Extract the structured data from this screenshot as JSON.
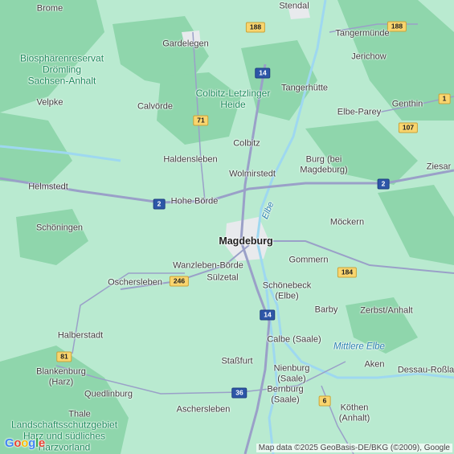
{
  "map": {
    "colors": {
      "land": "#b9ead0",
      "forest": "#8fd6ac",
      "urban": "#e8eaed",
      "road": "#9aa0c8",
      "river": "#9ed8f0"
    },
    "places": [
      {
        "id": "brome",
        "text": "Brome"
      },
      {
        "id": "stendal",
        "text": "Stendal"
      },
      {
        "id": "gardelegen",
        "text": "Gardelegen"
      },
      {
        "id": "tangermuende",
        "text": "Tangermünde"
      },
      {
        "id": "jerichow",
        "text": "Jerichow"
      },
      {
        "id": "tangerhuette",
        "text": "Tangerhütte"
      },
      {
        "id": "velpke",
        "text": "Velpke"
      },
      {
        "id": "calvoerde",
        "text": "Calvörde"
      },
      {
        "id": "genthin",
        "text": "Genthin"
      },
      {
        "id": "elbeparey",
        "text": "Elbe-Parey"
      },
      {
        "id": "colbitz",
        "text": "Colbitz"
      },
      {
        "id": "haldensleben",
        "text": "Haldensleben"
      },
      {
        "id": "burg",
        "text": "Burg (bei\nMagdeburg)"
      },
      {
        "id": "wolmirstedt",
        "text": "Wolmirstedt"
      },
      {
        "id": "ziesar",
        "text": "Ziesar"
      },
      {
        "id": "helmstedt",
        "text": "Helmstedt"
      },
      {
        "id": "hoheboerde",
        "text": "Hohe Börde"
      },
      {
        "id": "schoeningen",
        "text": "Schöningen"
      },
      {
        "id": "moeckern",
        "text": "Möckern"
      },
      {
        "id": "magdeburg",
        "text": "Magdeburg",
        "big": true
      },
      {
        "id": "gommern",
        "text": "Gommern"
      },
      {
        "id": "wanzleben",
        "text": "Wanzleben-Börde"
      },
      {
        "id": "suelzetal",
        "text": "Sülzetal"
      },
      {
        "id": "oschersleben",
        "text": "Oschersleben"
      },
      {
        "id": "schoenebeck",
        "text": "Schönebeck\n(Elbe)"
      },
      {
        "id": "barby",
        "text": "Barby"
      },
      {
        "id": "zerbst",
        "text": "Zerbst/Anhalt"
      },
      {
        "id": "halberstadt",
        "text": "Halberstadt"
      },
      {
        "id": "calbe",
        "text": "Calbe (Saale)"
      },
      {
        "id": "blankenburg",
        "text": "Blankenburg\n(Harz)"
      },
      {
        "id": "stassfurt",
        "text": "Staßfurt"
      },
      {
        "id": "nienburg",
        "text": "Nienburg\n(Saale)"
      },
      {
        "id": "aken",
        "text": "Aken"
      },
      {
        "id": "dessau",
        "text": "Dessau-Roßla"
      },
      {
        "id": "quedlinburg",
        "text": "Quedlinburg"
      },
      {
        "id": "bernburg",
        "text": "Bernburg\n(Saale)"
      },
      {
        "id": "thale",
        "text": "Thale"
      },
      {
        "id": "aschersleben",
        "text": "Aschersleben"
      },
      {
        "id": "koethen",
        "text": "Köthen\n(Anhalt)"
      }
    ],
    "areas": [
      {
        "id": "drömling",
        "text": "Biosphärenreservat\nDrömling\nSachsen-Anhalt",
        "kind": "park"
      },
      {
        "id": "colbitzheide",
        "text": "Colbitz-Letzlinger\nHeide",
        "kind": "park"
      },
      {
        "id": "harzvorland",
        "text": "Landschaftsschutzgebiet\nHarz und südliches\nHarzvorland",
        "kind": "park"
      },
      {
        "id": "mittlereelbe",
        "text": "Mittlere Elbe",
        "kind": "water"
      },
      {
        "id": "elbe",
        "text": "Elbe",
        "kind": "river"
      }
    ],
    "shields": [
      {
        "id": "b188a",
        "text": "188",
        "kind": "fed"
      },
      {
        "id": "b188b",
        "text": "188",
        "kind": "fed"
      },
      {
        "id": "a14n",
        "text": "14",
        "kind": "bab"
      },
      {
        "id": "b1",
        "text": "1",
        "kind": "fed"
      },
      {
        "id": "b71",
        "text": "71",
        "kind": "fed"
      },
      {
        "id": "b107",
        "text": "107",
        "kind": "fed"
      },
      {
        "id": "a2e",
        "text": "2",
        "kind": "bab"
      },
      {
        "id": "a2w",
        "text": "2",
        "kind": "bab"
      },
      {
        "id": "b184",
        "text": "184",
        "kind": "fed"
      },
      {
        "id": "b246",
        "text": "246",
        "kind": "fed"
      },
      {
        "id": "a14s",
        "text": "14",
        "kind": "bab"
      },
      {
        "id": "b81",
        "text": "81",
        "kind": "fed"
      },
      {
        "id": "a36",
        "text": "36",
        "kind": "bab"
      },
      {
        "id": "b6",
        "text": "6",
        "kind": "fed"
      }
    ],
    "logo": "Google",
    "attribution": "Map data ©2025 GeoBasis-DE/BKG (©2009), Google"
  }
}
